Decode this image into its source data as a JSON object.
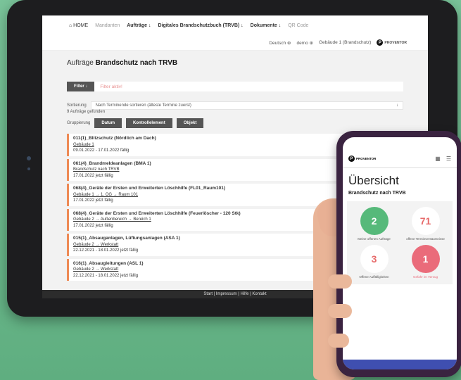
{
  "nav": {
    "home": "⌂ HOME",
    "mandanten": "Mandanten",
    "auftraege": "Aufträge ↓",
    "brandschutzbuch": "Digitales Brandschutzbuch (TRVB) ↓",
    "dokumente": "Dokumente ↓",
    "qr": "QR Code"
  },
  "subbar": {
    "language": "Deutsch ⊕",
    "user": "demo ⊕",
    "building": "Gebäude 1 (Brandschutz)",
    "logo": "PROVENTOR"
  },
  "page": {
    "title_prefix": "Aufträge",
    "title_bold": "Brandschutz nach TRVB",
    "filter_button": "Filter ↓",
    "filter_active": "Filter aktiv!",
    "sort_label": "Sortierung",
    "sort_value": "Nach Terminende sortieren (älteste Termine zuerst)",
    "sort_arrow": "↓",
    "found": "9 Aufträge gefunden",
    "group_label": "Gruppierung",
    "group_buttons": [
      "Datum",
      "Kontrollelement",
      "Objekt"
    ]
  },
  "orders": [
    {
      "title": "011(1)_Blitzschutz (Nördlich am Dach)",
      "path": "Gebäude 1",
      "due": "09.01.2022 - 17.01.2022 fällig"
    },
    {
      "title": "061(4)_Brandmeldeanlagen (BMA 1)",
      "path": "Brandschutz nach TRVB",
      "due": "17.01.2022 jetzt fällig"
    },
    {
      "title": "068(4)_Geräte der Ersten und Erweiterten Löschhilfe (FL01_Raum101)",
      "path": "Gebäude 1 → 1. OG → Raum 101",
      "due": "17.01.2022 jetzt fällig"
    },
    {
      "title": "068(4)_Geräte der Ersten und Erweiterten Löschhilfe (Feuerlöscher - 120 Stk)",
      "path": "Gebäude 2 → Außenbereich → Bereich 1",
      "due": "17.01.2022 jetzt fällig"
    },
    {
      "title": "015(1)_Absauganlagen, Lüftungsanlagen (ASA 1)",
      "path": "Gebäude 2 → Werkstatt",
      "due": "22.12.2021 - 18.01.2022 jetzt fällig"
    },
    {
      "title": "016(1)_Absaugleitungen (ASL 1)",
      "path": "Gebäude 2 → Werkstatt",
      "due": "22.12.2021 - 18.01.2022 jetzt fällig"
    }
  ],
  "footer": "Start | Impressum | Hilfe | Kontakt",
  "phone": {
    "logo": "PROVENTOR",
    "title": "Übersicht",
    "subtitle": "Brandschutz nach TRVB",
    "tiles": [
      {
        "value": "2",
        "caption": "Meine offenen Aufträge"
      },
      {
        "value": "71",
        "caption": "offene Terminversäumnisse"
      },
      {
        "value": "3",
        "caption": "Offene Auffälligkeiten"
      },
      {
        "value": "1",
        "caption": "Gefahr im Verzug"
      }
    ]
  },
  "colors": {
    "accent_orange": "#ee8a55",
    "green": "#56b97a",
    "red": "#ea6b7a",
    "blue_bar": "#3f4fb0"
  }
}
